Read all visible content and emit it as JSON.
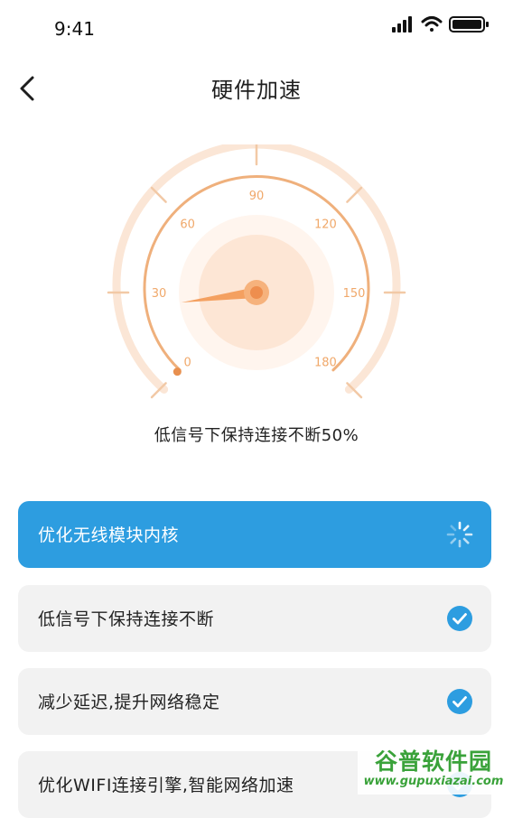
{
  "status_bar": {
    "time": "9:41"
  },
  "header": {
    "title": "硬件加速"
  },
  "gauge": {
    "tick_labels": [
      "0",
      "30",
      "60",
      "90",
      "120",
      "150",
      "180"
    ],
    "min": 0,
    "max": 180,
    "needle_value": 25,
    "accent_color": "#f0a86a"
  },
  "status_text": "低信号下保持连接不断50%",
  "tasks": [
    {
      "label": "优化无线模块内核",
      "state": "in-progress",
      "icon": "spinner-icon"
    },
    {
      "label": "低信号下保持连接不断",
      "state": "done",
      "icon": "check-circle-icon"
    },
    {
      "label": "减少延迟,提升网络稳定",
      "state": "done",
      "icon": "check-circle-icon"
    },
    {
      "label": "优化WIFI连接引擎,智能网络加速",
      "state": "done",
      "icon": "check-circle-icon"
    }
  ],
  "colors": {
    "primary": "#2d9de0",
    "card": "#f2f2f2",
    "gauge": "#f0a86a"
  },
  "watermark": {
    "title": "谷普软件园",
    "url": "www.gupuxiazai.com"
  }
}
